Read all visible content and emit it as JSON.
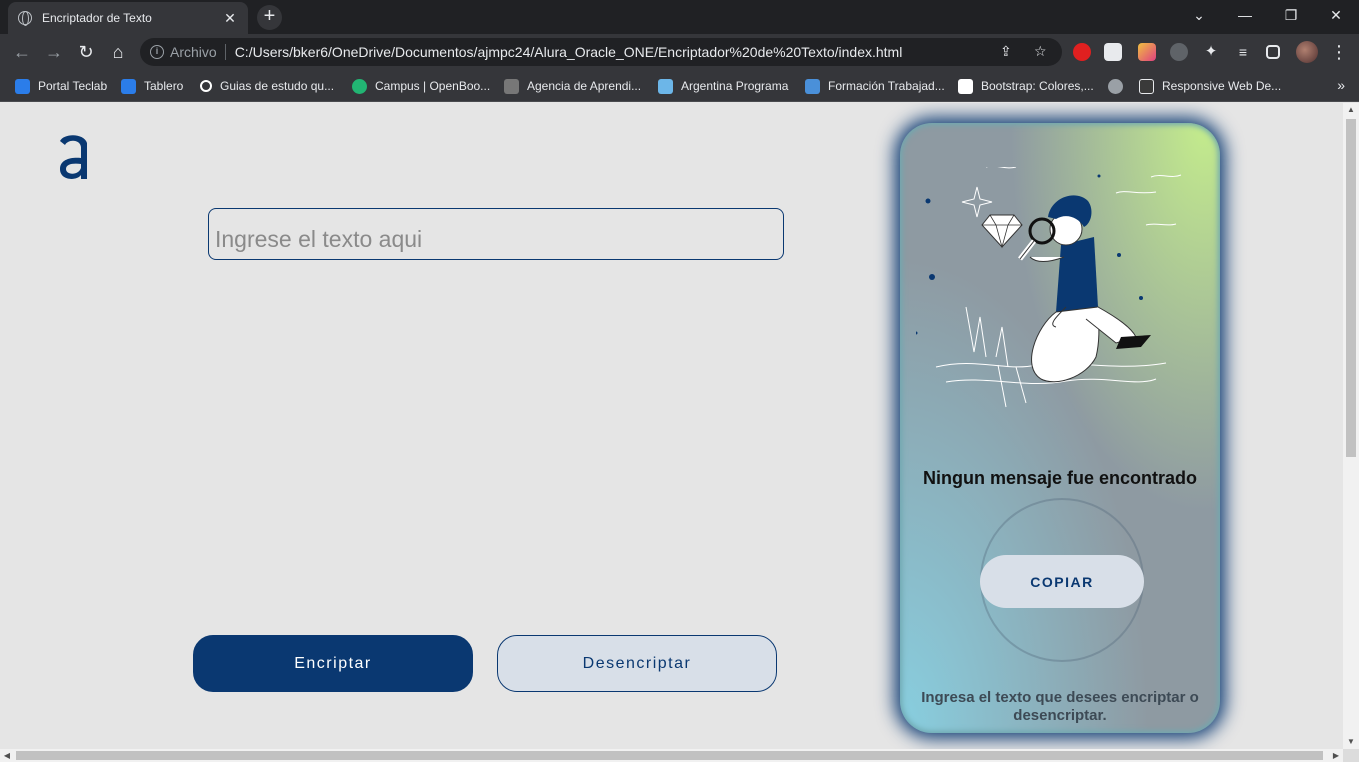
{
  "browser": {
    "tab_title": "Encriptador de Texto",
    "tab_close": "✕",
    "new_tab": "+",
    "window_controls": {
      "minimize": "—",
      "restore": "❐",
      "close": "✕",
      "tab_search": "⌄"
    },
    "nav": {
      "back": "←",
      "forward": "→",
      "reload": "↻",
      "home": "⌂"
    },
    "address": {
      "scheme_label": "Archivo",
      "url": "C:/Users/bker6/OneDrive/Documentos/ajmpc24/Alura_Oracle_ONE/Encriptador%20de%20Texto/index.html",
      "share_icon": "⇪",
      "bookmark_icon": "☆"
    },
    "menu_icon": "⋮",
    "bookmarks": [
      {
        "label": "Portal Teclab",
        "color": "#2b7de9"
      },
      {
        "label": "Tablero",
        "color": "#2b7de9"
      },
      {
        "label": "Guias de estudo qu...",
        "color": "#ffffff"
      },
      {
        "label": "Campus | OpenBoo...",
        "color": "#22b573"
      },
      {
        "label": "Agencia de Aprendi...",
        "color": "#777777"
      },
      {
        "label": "Argentina Programa",
        "color": "#6cb6e8"
      },
      {
        "label": "Formación Trabajad...",
        "color": "#4a90d9"
      },
      {
        "label": "Bootstrap: Colores,...",
        "color": "#ffffff"
      },
      {
        "label": "Responsive Web De...",
        "color": "#3a3a3a"
      }
    ],
    "bookmarks_more": "»"
  },
  "page": {
    "logo_icon": "alura-logo-icon",
    "input": {
      "placeholder": "Ingrese el texto aqui",
      "value": ""
    },
    "buttons": {
      "encrypt": "Encriptar",
      "decrypt": "Desencriptar"
    },
    "panel": {
      "title": "Ningun mensaje fue encontrado",
      "copy": "COPIAR",
      "subtitle": "Ingresa el texto que desees encriptar o desencriptar."
    }
  },
  "colors": {
    "primary": "#0a3871",
    "background": "#e5e5e5",
    "secondary_button": "#d8dfe8",
    "panel_green": "#c4ec8c",
    "panel_blue": "#88cfe0"
  }
}
